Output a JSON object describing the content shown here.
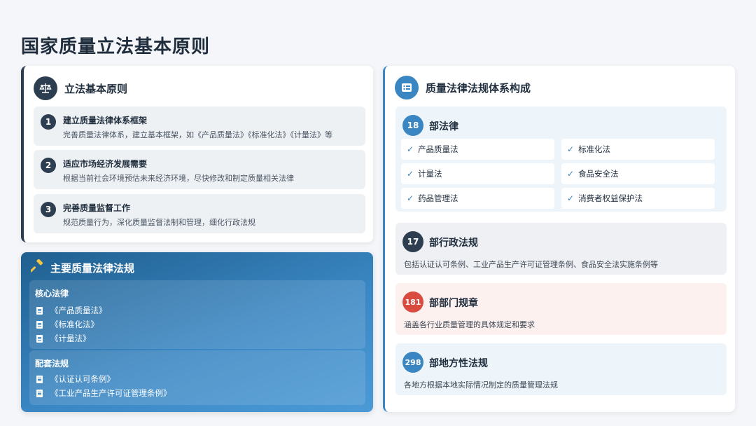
{
  "page": {
    "title": "国家质量立法基本原则"
  },
  "principles": {
    "title": "立法基本原则",
    "icon": "scale-icon",
    "items": [
      {
        "num": "1",
        "title": "建立质量法律体系框架",
        "desc": "完善质量法律体系，建立基本框架，如《产品质量法》《标准化法》《计量法》等"
      },
      {
        "num": "2",
        "title": "适应市场经济发展需要",
        "desc": "根据当前社会环境预估未来经济环境，尽快修改和制定质量相关法律"
      },
      {
        "num": "3",
        "title": "完善质量监督工作",
        "desc": "规范质量行为，深化质量监督法制和管理，细化行政法规"
      }
    ]
  },
  "main_laws": {
    "title": "主要质量法律法规",
    "icon": "gavel-icon",
    "core": {
      "title": "核心法律",
      "items": [
        "《产品质量法》",
        "《标准化法》",
        "《计量法》"
      ]
    },
    "supporting": {
      "title": "配套法规",
      "items": [
        "《认证认可条例》",
        "《工业产品生产许可证管理条例》"
      ]
    }
  },
  "system": {
    "title": "质量法律法规体系构成",
    "icon": "list-icon",
    "laws": {
      "count": "18",
      "label": "部法律",
      "items": [
        "产品质量法",
        "标准化法",
        "计量法",
        "食品安全法",
        "药品管理法",
        "消费者权益保护法"
      ]
    },
    "admin": {
      "count": "17",
      "label": "部行政法规",
      "desc": "包括认证认可条例、工业产品生产许可证管理条例、食品安全法实施条例等"
    },
    "dept": {
      "count": "181",
      "label": "部部门规章",
      "desc": "涵盖各行业质量管理的具体规定和要求"
    },
    "local": {
      "count": "298",
      "label": "部地方性法规",
      "desc": "各地方根据本地实际情况制定的质量管理法规"
    }
  },
  "colors": {
    "navy": "#2c3e50",
    "blue": "#3a86c2",
    "red": "#d94a3f",
    "check": "#3a86c2"
  }
}
